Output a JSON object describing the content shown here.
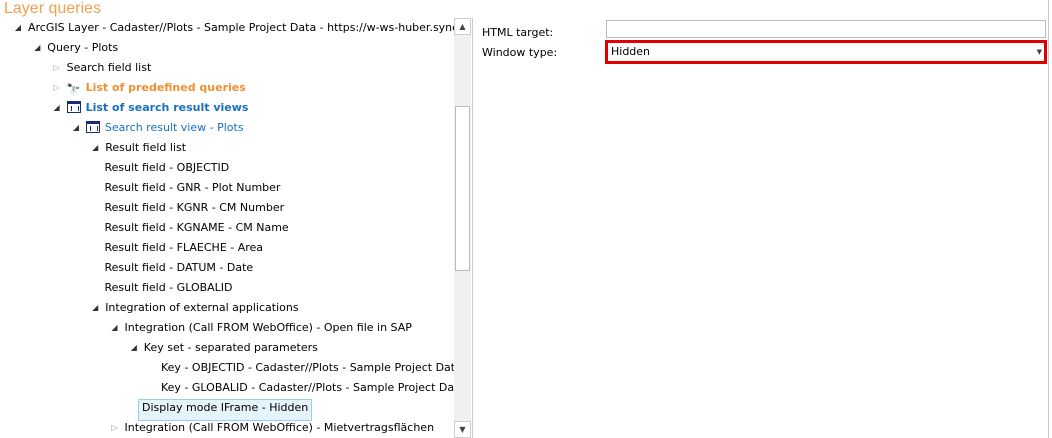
{
  "title": "Layer queries",
  "tree": [
    {
      "label": "ArcGIS Layer - Cadaster//Plots - Sample Project Data - https://w-ws-huber.synergis.in",
      "level": 0,
      "state": "open"
    },
    {
      "label": "Query - Plots",
      "level": 1,
      "state": "open"
    },
    {
      "label": "Search field list",
      "level": 2,
      "state": "closed"
    },
    {
      "label": "List of predefined queries",
      "level": 2,
      "state": "closed",
      "icon": "binoculars-icon",
      "style": "orange"
    },
    {
      "label": "List of search result views",
      "level": 2,
      "state": "open",
      "icon": "table-icon",
      "style": "blue"
    },
    {
      "label": "Search result view - Plots",
      "level": 3,
      "state": "open",
      "icon": "table-icon",
      "style": "lblue"
    },
    {
      "label": "Result field list",
      "level": 4,
      "state": "open"
    },
    {
      "label": "Result field - OBJECTID",
      "level": 5
    },
    {
      "label": "Result field - GNR - Plot Number",
      "level": 5
    },
    {
      "label": "Result field - KGNR - CM Number",
      "level": 5
    },
    {
      "label": "Result field - KGNAME - CM Name",
      "level": 5
    },
    {
      "label": "Result field - FLAECHE - Area",
      "level": 5
    },
    {
      "label": "Result field - DATUM - Date",
      "level": 5
    },
    {
      "label": "Result field - GLOBALID",
      "level": 5
    },
    {
      "label": "Integration of external applications",
      "level": 4,
      "state": "open"
    },
    {
      "label": "Integration (Call FROM WebOffice) - Open file in SAP",
      "level": 5,
      "state": "open"
    },
    {
      "label": "Key set - separated parameters",
      "level": 6,
      "state": "open"
    },
    {
      "label": "Key - OBJECTID - Cadaster//Plots - Sample Project Data -",
      "level": 8
    },
    {
      "label": "Key - GLOBALID - Cadaster//Plots - Sample Project Data -",
      "level": 8
    },
    {
      "label": "Display mode IFrame - Hidden",
      "level": 6,
      "selected": true
    },
    {
      "label": "Integration (Call FROM WebOffice) - Mietvertragsflächen",
      "level": 5,
      "state": "closed"
    }
  ],
  "props": {
    "html_target_label": "HTML target:",
    "html_target_value": "",
    "window_type_label": "Window type:",
    "window_type_value": "Hidden"
  },
  "colors": {
    "title": "#f0a050",
    "highlight": "#e00000",
    "link": "#1a6fc0"
  }
}
